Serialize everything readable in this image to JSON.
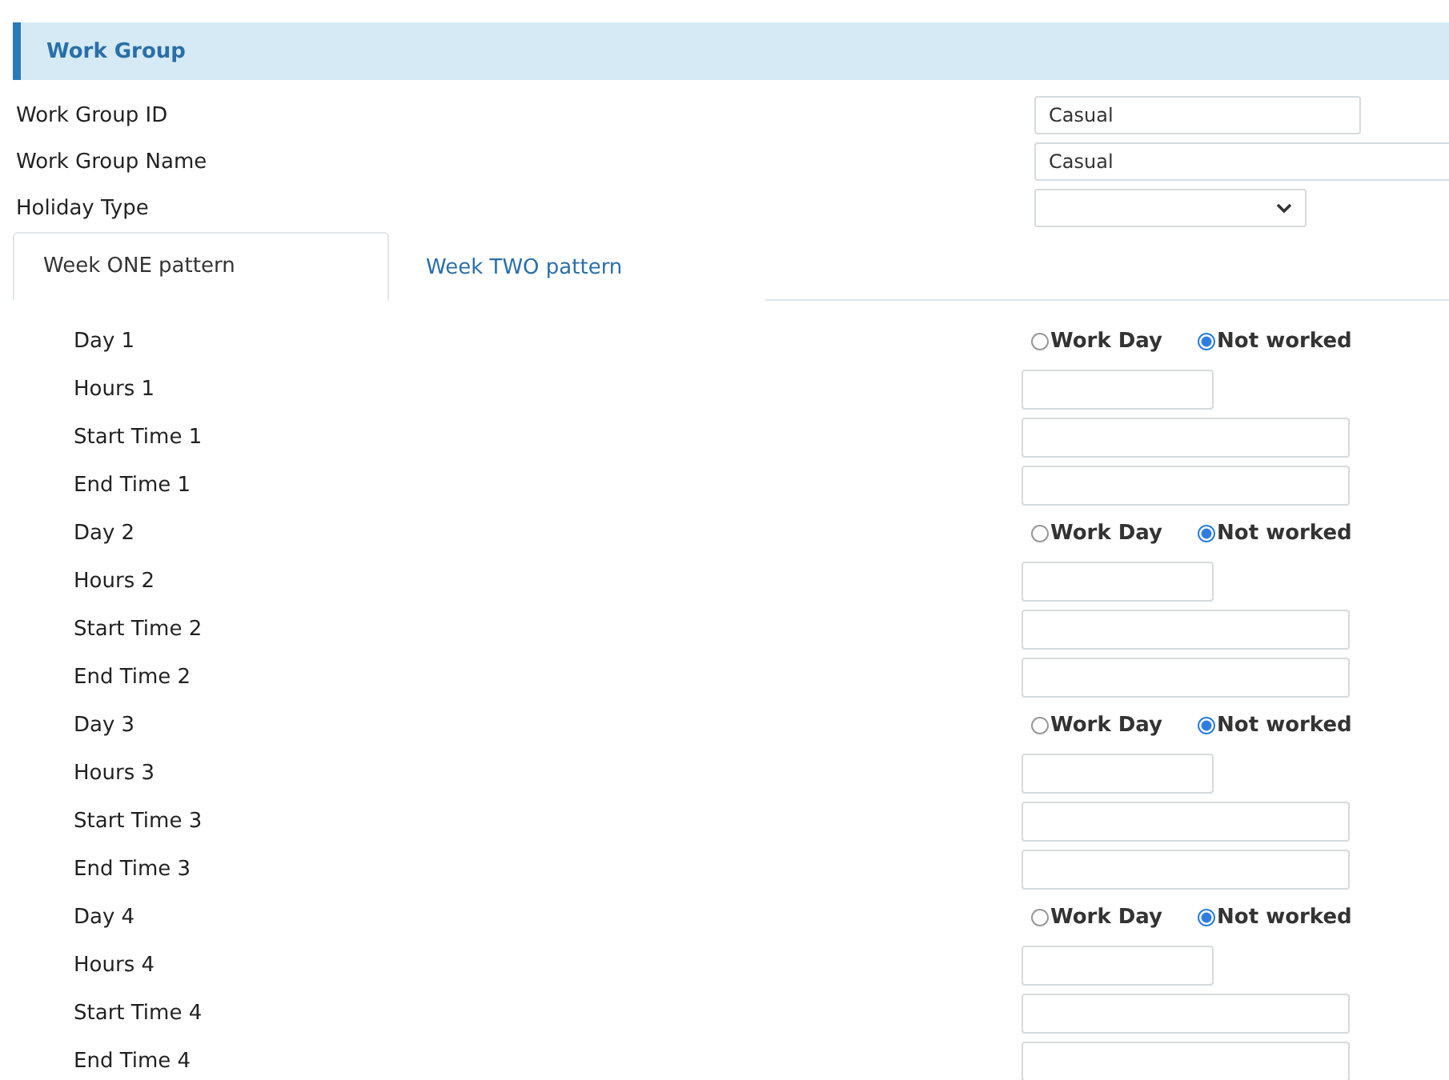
{
  "section": {
    "title": "Work Group"
  },
  "fields": [
    {
      "label": "Work Group ID",
      "kind": "text",
      "value": "Casual"
    },
    {
      "label": "Work Group Name",
      "kind": "wide",
      "value": "Casual"
    },
    {
      "label": "Holiday Type",
      "kind": "select"
    }
  ],
  "tabs": [
    {
      "label": "Week ONE pattern",
      "selected": true
    },
    {
      "label": "Week TWO pattern",
      "selected": false
    }
  ],
  "days": [
    {
      "label": "Day 1",
      "options": [
        {
          "label": "Work Day",
          "selected": false
        },
        {
          "label": "Not worked",
          "selected": true
        }
      ],
      "fields": [
        {
          "label": "Hours 1",
          "kind": "short"
        },
        {
          "label": "Start Time 1",
          "kind": "long"
        },
        {
          "label": "End Time 1",
          "kind": "long"
        }
      ]
    },
    {
      "label": "Day 2",
      "options": [
        {
          "label": "Work Day",
          "selected": false
        },
        {
          "label": "Not worked",
          "selected": true
        }
      ],
      "fields": [
        {
          "label": "Hours 2",
          "kind": "short"
        },
        {
          "label": "Start Time 2",
          "kind": "long"
        },
        {
          "label": "End Time 2",
          "kind": "long"
        }
      ]
    },
    {
      "label": "Day 3",
      "options": [
        {
          "label": "Work Day",
          "selected": false
        },
        {
          "label": "Not worked",
          "selected": true
        }
      ],
      "fields": [
        {
          "label": "Hours 3",
          "kind": "short"
        },
        {
          "label": "Start Time 3",
          "kind": "long"
        },
        {
          "label": "End Time 3",
          "kind": "long"
        }
      ]
    },
    {
      "label": "Day 4",
      "options": [
        {
          "label": "Work Day",
          "selected": false
        },
        {
          "label": "Not worked",
          "selected": true
        }
      ],
      "fields": [
        {
          "label": "Hours 4",
          "kind": "short"
        },
        {
          "label": "Start Time 4",
          "kind": "long"
        },
        {
          "label": "End Time 4",
          "kind": "long"
        }
      ]
    }
  ]
}
